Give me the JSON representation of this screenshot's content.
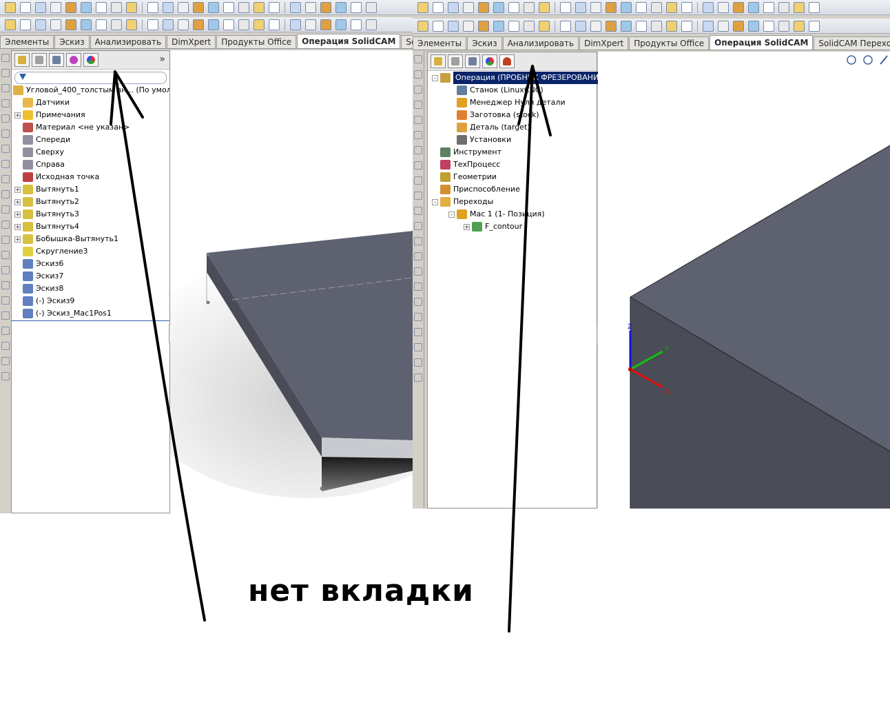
{
  "left": {
    "tabs": [
      "Элементы",
      "Эскиз",
      "Анализировать",
      "DimXpert",
      "Продукты Office",
      "Операция SolidCAM",
      "SolidCAM П"
    ],
    "active_tab_index": 5,
    "chevron": "»",
    "root_label": "Угловой_400_толстым вн... (По умол",
    "tree": [
      {
        "label": "Датчики",
        "expand": "",
        "icon": "sensor-icon",
        "color": "#e8b84a"
      },
      {
        "label": "Примечания",
        "expand": "+",
        "icon": "annotation-icon",
        "color": "#f0c030"
      },
      {
        "label": "Материал <не указан>",
        "expand": "",
        "icon": "material-icon",
        "color": "#c05050"
      },
      {
        "label": "Спереди",
        "expand": "",
        "icon": "plane-icon",
        "color": "#9090a0"
      },
      {
        "label": "Сверху",
        "expand": "",
        "icon": "plane-icon",
        "color": "#9090a0"
      },
      {
        "label": "Справа",
        "expand": "",
        "icon": "plane-icon",
        "color": "#9090a0"
      },
      {
        "label": "Исходная точка",
        "expand": "",
        "icon": "origin-icon",
        "color": "#c04040"
      },
      {
        "label": "Вытянуть1",
        "expand": "+",
        "icon": "extrude-icon",
        "color": "#d8c040"
      },
      {
        "label": "Вытянуть2",
        "expand": "+",
        "icon": "extrude-icon",
        "color": "#d8c040"
      },
      {
        "label": "Вытянуть3",
        "expand": "+",
        "icon": "extrude-icon",
        "color": "#d8c040"
      },
      {
        "label": "Вытянуть4",
        "expand": "+",
        "icon": "extrude-icon",
        "color": "#d8c040"
      },
      {
        "label": "Бобышка-Вытянуть1",
        "expand": "+",
        "icon": "boss-extrude-icon",
        "color": "#d8c040"
      },
      {
        "label": "Скругление3",
        "expand": "",
        "icon": "fillet-icon",
        "color": "#e0d040"
      },
      {
        "label": "Эскиз6",
        "expand": "",
        "icon": "sketch-icon",
        "color": "#6080c0"
      },
      {
        "label": "Эскиз7",
        "expand": "",
        "icon": "sketch-icon",
        "color": "#6080c0"
      },
      {
        "label": "Эскиз8",
        "expand": "",
        "icon": "sketch-icon",
        "color": "#6080c0"
      },
      {
        "label": "(-) Эскиз9",
        "expand": "",
        "icon": "sketch-icon",
        "color": "#6080c0"
      },
      {
        "label": "(-) Эскиз_Mac1Pos1",
        "expand": "",
        "icon": "3d-sketch-icon",
        "color": "#6080c0"
      }
    ]
  },
  "right": {
    "tabs": [
      "Элементы",
      "Эскиз",
      "Анализировать",
      "DimXpert",
      "Продукты Office",
      "Операция SolidCAM",
      "SolidCAM Переходы"
    ],
    "active_tab_index": 5,
    "tree": [
      {
        "label": "Операция (ПРОБНИК ФРЕЗЕРОВАНИЕ)",
        "expand": "-",
        "icon": "operation-icon",
        "color": "#c8a040",
        "selected": true
      },
      {
        "label": "Станок (LinuxCNC)",
        "expand": "",
        "icon": "machine-icon",
        "color": "#6080a0"
      },
      {
        "label": "Менеджер Нуля детали",
        "expand": "",
        "icon": "zero-manager-icon",
        "color": "#e0a020"
      },
      {
        "label": "Заготовка (stock)",
        "expand": "",
        "icon": "stock-icon",
        "color": "#e08030"
      },
      {
        "label": "Деталь (target)",
        "expand": "",
        "icon": "part-icon",
        "color": "#e0a040"
      },
      {
        "label": "Установки",
        "expand": "",
        "icon": "settings-icon",
        "color": "#707070"
      },
      {
        "label": "Инструмент",
        "expand": "",
        "icon": "tool-icon",
        "color": "#608060"
      },
      {
        "label": "ТехПроцесс",
        "expand": "",
        "icon": "process-icon",
        "color": "#c04060"
      },
      {
        "label": "Геометрии",
        "expand": "",
        "icon": "geometry-icon",
        "color": "#c0a030"
      },
      {
        "label": "Приспособление",
        "expand": "",
        "icon": "fixture-icon",
        "color": "#d09030"
      },
      {
        "label": "Переходы",
        "expand": "-",
        "icon": "folder-icon",
        "color": "#e0b040"
      },
      {
        "label": "Mac 1 (1- Позиция)",
        "expand": "-",
        "icon": "position-icon",
        "color": "#e0a020"
      },
      {
        "label": "F_contour",
        "expand": "+",
        "icon": "contour-icon",
        "color": "#50a050"
      }
    ],
    "axis": {
      "x": "X",
      "y": "Y",
      "z": "Z"
    }
  },
  "caption": "нет вкладки",
  "colors": {
    "accent": "#0a246a",
    "part_face": "#5e6170",
    "part_side": "#3c3e48"
  }
}
